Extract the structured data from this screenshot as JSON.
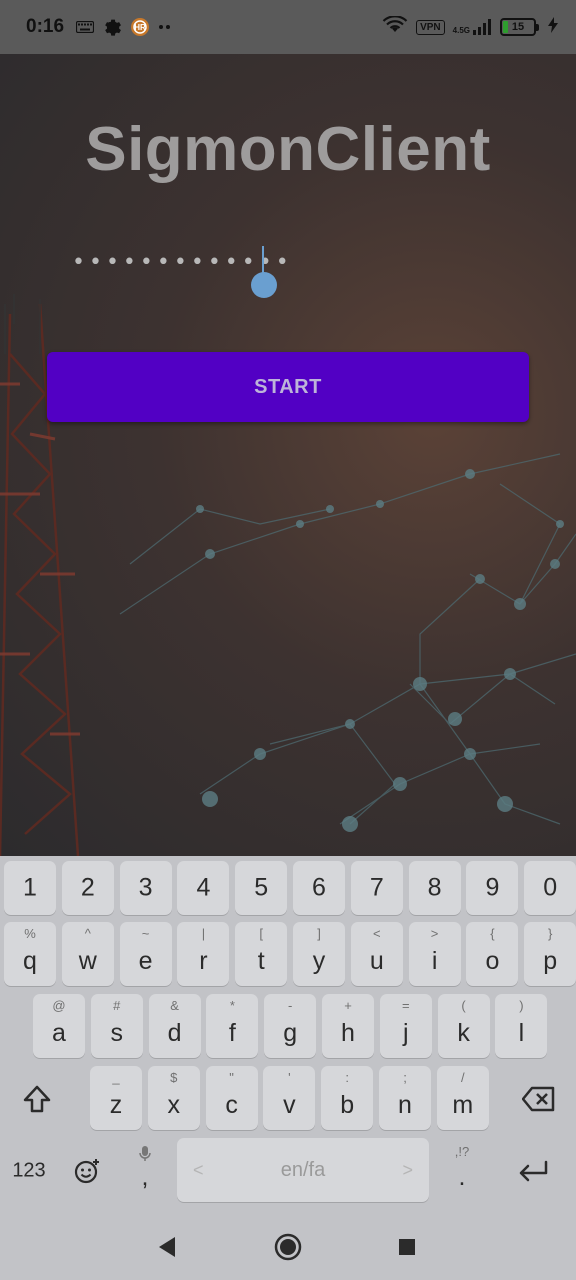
{
  "status_bar": {
    "time": "0:16",
    "icons": [
      "keyboard-icon",
      "gear-icon",
      "app-notification-icon",
      "more-dots-icon"
    ],
    "vpn_label": "VPN",
    "network_label": "4.5G",
    "battery_level": "15"
  },
  "app": {
    "title": "SigmonClient",
    "password_mask": "•••••••••••••",
    "start_label": "START",
    "accent_color": "#5200c4",
    "cursor_color": "#6a9fd0"
  },
  "keyboard": {
    "number_row": [
      "1",
      "2",
      "3",
      "4",
      "5",
      "6",
      "7",
      "8",
      "9",
      "0"
    ],
    "row1": [
      {
        "hint": "%",
        "key": "q"
      },
      {
        "hint": "^",
        "key": "w"
      },
      {
        "hint": "~",
        "key": "e"
      },
      {
        "hint": "|",
        "key": "r"
      },
      {
        "hint": "[",
        "key": "t"
      },
      {
        "hint": "]",
        "key": "y"
      },
      {
        "hint": "<",
        "key": "u"
      },
      {
        "hint": ">",
        "key": "i"
      },
      {
        "hint": "{",
        "key": "o"
      },
      {
        "hint": "}",
        "key": "p"
      }
    ],
    "row2": [
      {
        "hint": "@",
        "key": "a"
      },
      {
        "hint": "#",
        "key": "s"
      },
      {
        "hint": "&",
        "key": "d"
      },
      {
        "hint": "*",
        "key": "f"
      },
      {
        "hint": "-",
        "key": "g"
      },
      {
        "hint": "+",
        "key": "h"
      },
      {
        "hint": "=",
        "key": "j"
      },
      {
        "hint": "(",
        "key": "k"
      },
      {
        "hint": ")",
        "key": "l"
      }
    ],
    "row3": [
      {
        "hint": "_",
        "key": "z"
      },
      {
        "hint": "$",
        "key": "x"
      },
      {
        "hint": "\"",
        "key": "c"
      },
      {
        "hint": "'",
        "key": "v"
      },
      {
        "hint": ":",
        "key": "b"
      },
      {
        "hint": ";",
        "key": "n"
      },
      {
        "hint": "/",
        "key": "m"
      }
    ],
    "symbols_label": "123",
    "comma_label": ",",
    "space_label": "en/fa",
    "space_left": "<",
    "space_right": ">",
    "period_hint": ",!?",
    "period_label": "."
  }
}
